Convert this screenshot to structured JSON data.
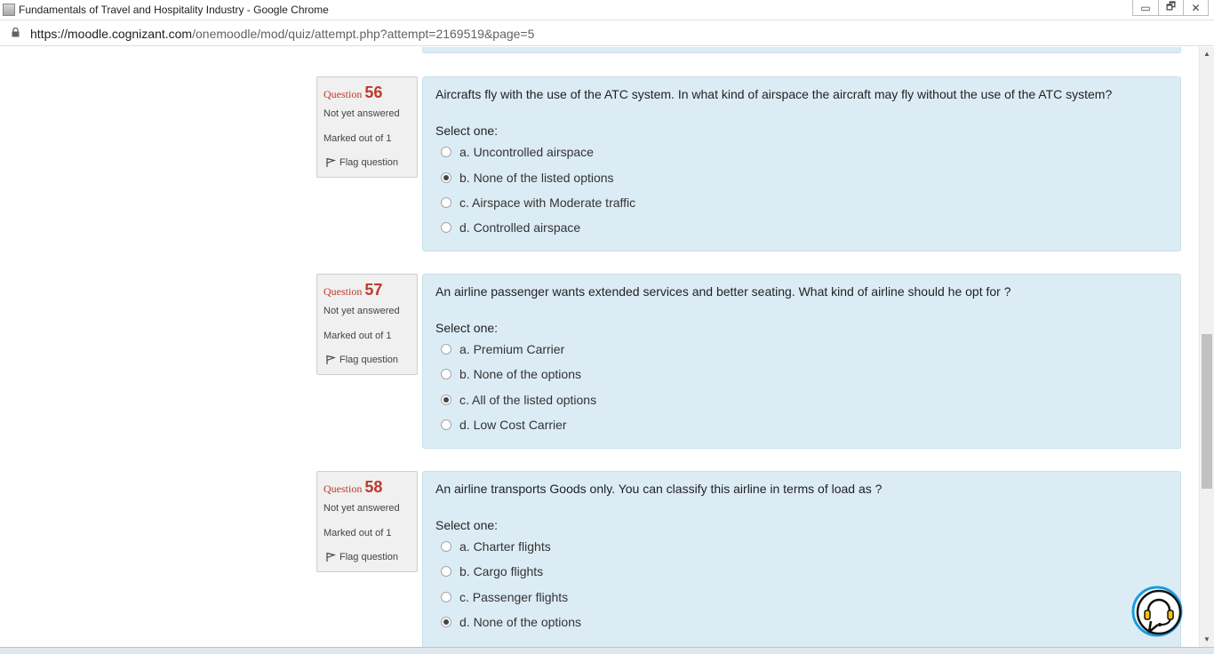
{
  "window": {
    "title": "Fundamentals of Travel and Hospitality Industry - Google Chrome",
    "controls": [
      "▭",
      "🗗",
      "✕"
    ]
  },
  "address": {
    "host": "https://moodle.cognizant.com",
    "path": "/onemoodle/mod/quiz/attempt.php?attempt=2169519&page=5"
  },
  "quiz": {
    "questions": [
      {
        "label": "Question",
        "number": "56",
        "state": "Not yet answered",
        "grade": "Marked out of 1",
        "flag": "Flag question",
        "text": "Aircrafts fly with the use of the ATC system. In what kind of airspace the aircraft may fly without the use of the ATC system?",
        "prompt": "Select one:",
        "options": [
          {
            "label": "a. Uncontrolled airspace",
            "checked": false
          },
          {
            "label": "b. None of the listed options",
            "checked": true
          },
          {
            "label": "c. Airspace with Moderate traffic",
            "checked": false
          },
          {
            "label": "d. Controlled airspace",
            "checked": false
          }
        ]
      },
      {
        "label": "Question",
        "number": "57",
        "state": "Not yet answered",
        "grade": "Marked out of 1",
        "flag": "Flag question",
        "text": "An airline passenger wants extended services and better seating. What kind of airline should he opt for ?",
        "prompt": "Select one:",
        "options": [
          {
            "label": "a. Premium Carrier",
            "checked": false
          },
          {
            "label": "b. None of the options",
            "checked": false
          },
          {
            "label": "c. All of the listed options",
            "checked": true
          },
          {
            "label": "d. Low Cost Carrier",
            "checked": false
          }
        ]
      },
      {
        "label": "Question",
        "number": "58",
        "state": "Not yet answered",
        "grade": "Marked out of 1",
        "flag": "Flag question",
        "text": "An airline transports Goods only. You can classify this airline in terms of load as ?",
        "prompt": "Select one:",
        "options": [
          {
            "label": "a. Charter flights",
            "checked": false
          },
          {
            "label": "b. Cargo flights",
            "checked": false
          },
          {
            "label": "c. Passenger flights",
            "checked": false
          },
          {
            "label": "d. None of the options",
            "checked": true
          }
        ]
      }
    ]
  },
  "colors": {
    "question_number": "#c0392b",
    "content_bg": "#dcecf5",
    "info_bg": "#f0f0f0"
  },
  "icons": {
    "flag": "flag-icon",
    "lock": "lock-icon",
    "help": "headset-help-icon"
  }
}
